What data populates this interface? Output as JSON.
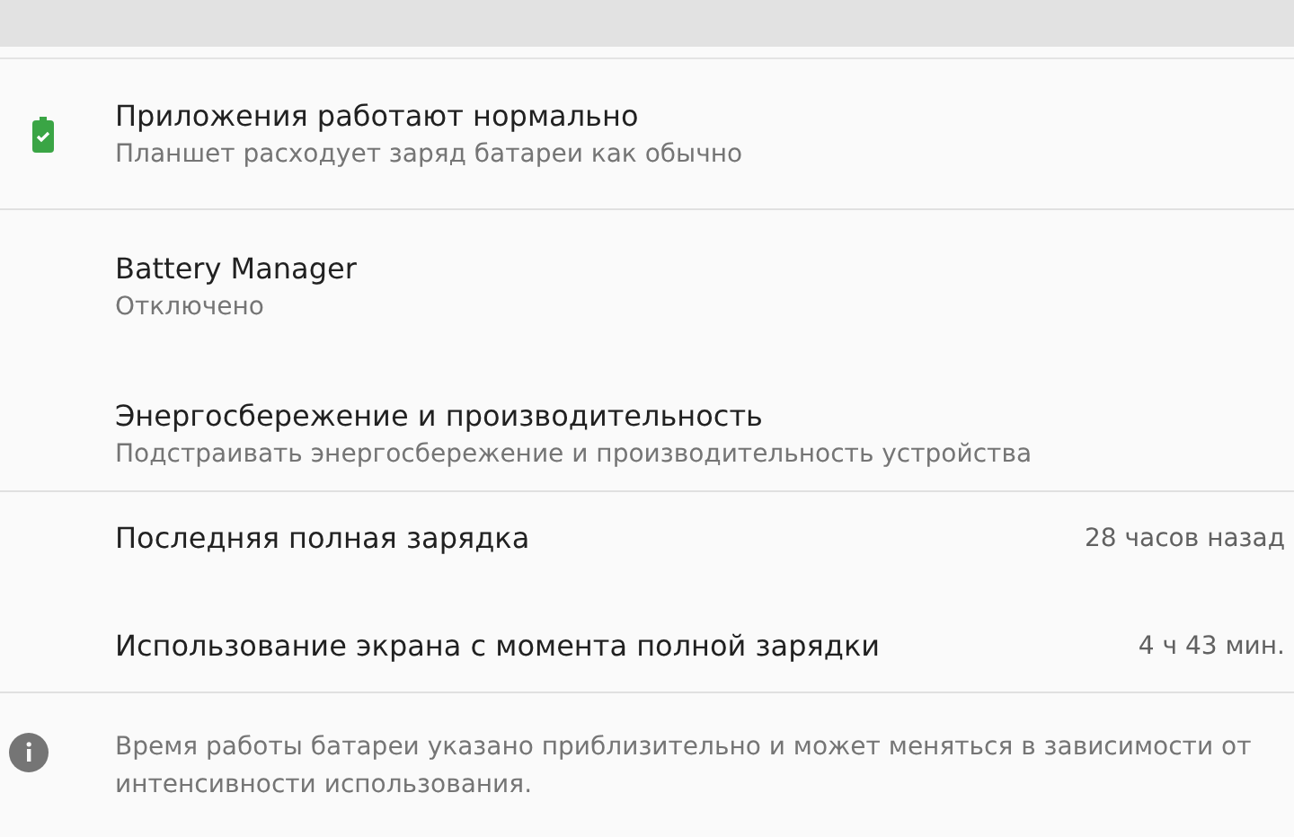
{
  "status": {
    "title": "Приложения работают нормально",
    "subtitle": "Планшет расходует заряд батареи как обычно"
  },
  "settings": [
    {
      "title": "Battery Manager",
      "subtitle": "Отключено"
    },
    {
      "title": "Энергосбережение и производительность",
      "subtitle": "Подстраивать энергосбережение и производительность устройства"
    }
  ],
  "stats": [
    {
      "label": "Последняя полная зарядка",
      "value": "28 часов назад"
    },
    {
      "label": "Использование экрана с момента полной зарядки",
      "value": "4 ч 43 мин."
    }
  ],
  "note": "Время работы батареи указано приблизительно и может меняться в зависимости от интенсивности использования."
}
